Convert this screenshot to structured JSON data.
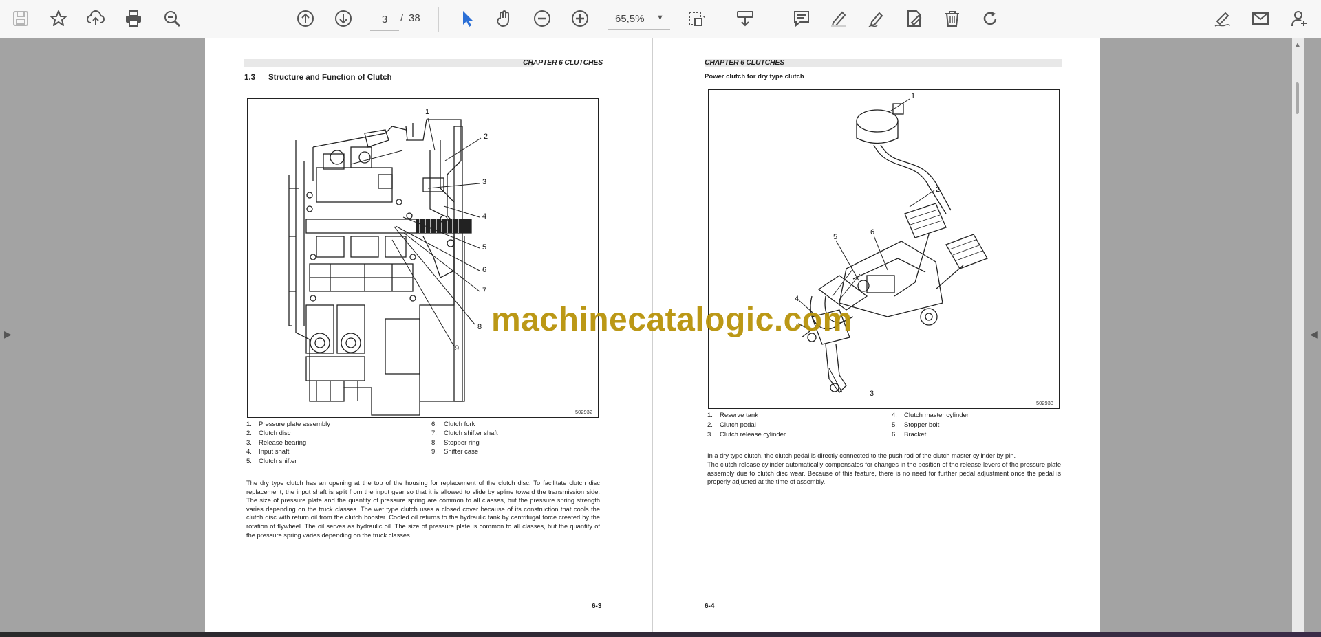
{
  "toolbar": {
    "page_current": "3",
    "page_separator": "/",
    "page_total": "38",
    "zoom": "65,5%",
    "icons": [
      "save-icon",
      "bookmark-star-icon",
      "upload-cloud-icon",
      "print-icon",
      "zoom-search-icon",
      "previous-page-icon",
      "next-page-icon",
      "select-cursor-icon",
      "hand-tool-icon",
      "zoom-out-icon",
      "zoom-in-icon",
      "marquee-zoom-icon",
      "download-icon",
      "comment-icon",
      "highlight-pen-icon",
      "draw-pen-icon",
      "fill-sign-icon",
      "delete-icon",
      "rotate-icon",
      "signature-icon",
      "email-icon",
      "add-user-icon"
    ],
    "accent_color": "#2b6fd6"
  },
  "watermark": "machinecatalogic.com",
  "left_page": {
    "chapter": "CHAPTER 6 CLUTCHES",
    "section_number": "1.3",
    "section_title": "Structure and Function of Clutch",
    "figure_code": "502932",
    "callouts": [
      "1",
      "2",
      "3",
      "4",
      "5",
      "6",
      "7",
      "8",
      "9"
    ],
    "legend": [
      {
        "n": "1.",
        "label": "Pressure plate assembly"
      },
      {
        "n": "2.",
        "label": "Clutch disc"
      },
      {
        "n": "3.",
        "label": "Release bearing"
      },
      {
        "n": "4.",
        "label": "Input shaft"
      },
      {
        "n": "5.",
        "label": "Clutch shifter"
      },
      {
        "n": "6.",
        "label": "Clutch fork"
      },
      {
        "n": "7.",
        "label": "Clutch shifter shaft"
      },
      {
        "n": "8.",
        "label": "Stopper ring"
      },
      {
        "n": "9.",
        "label": "Shifter case"
      }
    ],
    "paragraph": "The dry type clutch has an opening at the top of the housing for replacement of the clutch disc. To facilitate clutch disc replacement, the input shaft is split from the input gear so that it is allowed to slide by spline toward the transmission side. The size of pressure plate and the quantity of pressure spring are common to all classes, but the pressure spring strength varies depending on the truck classes. The wet type clutch uses a closed cover because of its construction that cools the clutch disc with return oil from the clutch booster. Cooled oil returns to the hydraulic tank by centrifugal force created by the rotation of flywheel. The oil serves as hydraulic oil. The size of pressure plate is common to all classes, but the quantity of the pressure spring varies depending on the truck classes.",
    "page_number": "6-3"
  },
  "right_page": {
    "chapter": "CHAPTER 6 CLUTCHES",
    "figure_title": "Power clutch for dry type clutch",
    "figure_code": "502933",
    "callouts": [
      "1",
      "2",
      "3",
      "4",
      "5",
      "6"
    ],
    "legend": [
      {
        "n": "1.",
        "label": "Reserve tank"
      },
      {
        "n": "2.",
        "label": "Clutch pedal"
      },
      {
        "n": "3.",
        "label": "Clutch release cylinder"
      },
      {
        "n": "4.",
        "label": "Clutch master cylinder"
      },
      {
        "n": "5.",
        "label": "Stopper bolt"
      },
      {
        "n": "6.",
        "label": "Bracket"
      }
    ],
    "paragraph_1": "In a dry type clutch, the clutch pedal is directly connected to the push rod of the clutch master cylinder by pin.",
    "paragraph_2": "The clutch release cylinder automatically compensates for changes in the position of the release levers of the pressure plate assembly due to clutch disc wear. Because of this feature, there is no need for further pedal adjustment once the pedal is properly adjusted at the time of assembly.",
    "page_number": "6-4"
  }
}
